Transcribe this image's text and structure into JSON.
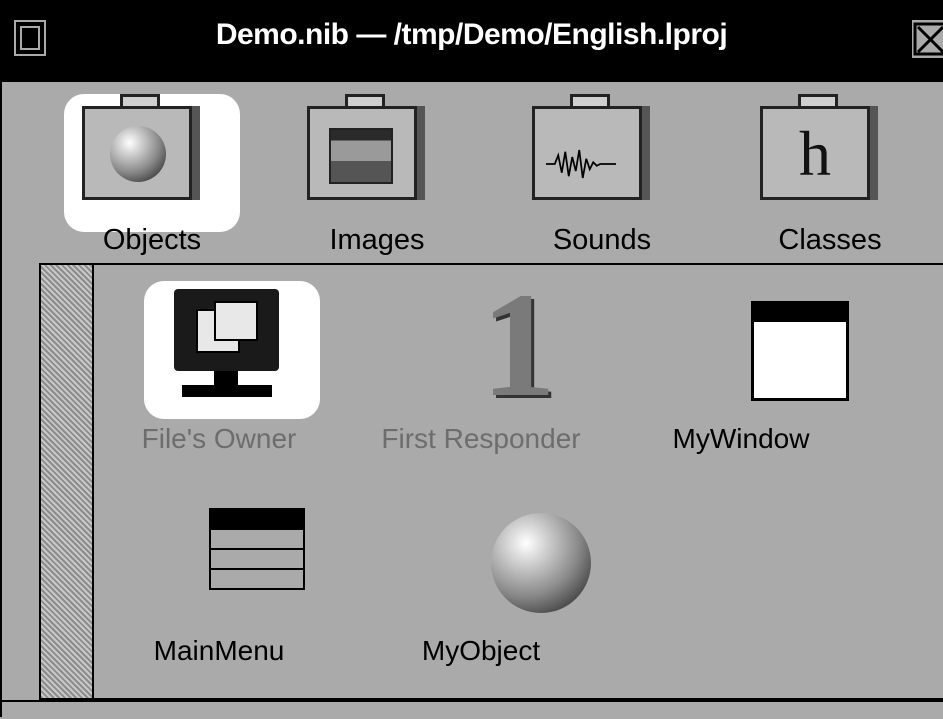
{
  "window": {
    "title": "Demo.nib  —  /tmp/Demo/English.lproj"
  },
  "tabs": [
    {
      "label": "Objects",
      "icon": "suitcase-sphere-icon",
      "selected": true
    },
    {
      "label": "Images",
      "icon": "suitcase-image-icon",
      "selected": false
    },
    {
      "label": "Sounds",
      "icon": "suitcase-waveform-icon",
      "selected": false
    },
    {
      "label": "Classes",
      "icon": "suitcase-h-icon",
      "selected": false
    }
  ],
  "objects": [
    {
      "label": "File's Owner",
      "icon": "monitor-icon",
      "selected": true,
      "dimmed": true
    },
    {
      "label": "First Responder",
      "icon": "number-one-icon",
      "selected": false,
      "dimmed": true
    },
    {
      "label": "MyWindow",
      "icon": "window-icon",
      "selected": false,
      "dimmed": false
    },
    {
      "label": "MainMenu",
      "icon": "menu-icon",
      "selected": false,
      "dimmed": false
    },
    {
      "label": "MyObject",
      "icon": "sphere-icon",
      "selected": false,
      "dimmed": false
    }
  ],
  "classes_tab_glyph": "h",
  "first_responder_glyph": "1",
  "colors": {
    "background": "#aaaaaa",
    "titlebar": "#000000",
    "selection": "#ffffff",
    "dimmed_text": "#6d6d6d"
  }
}
